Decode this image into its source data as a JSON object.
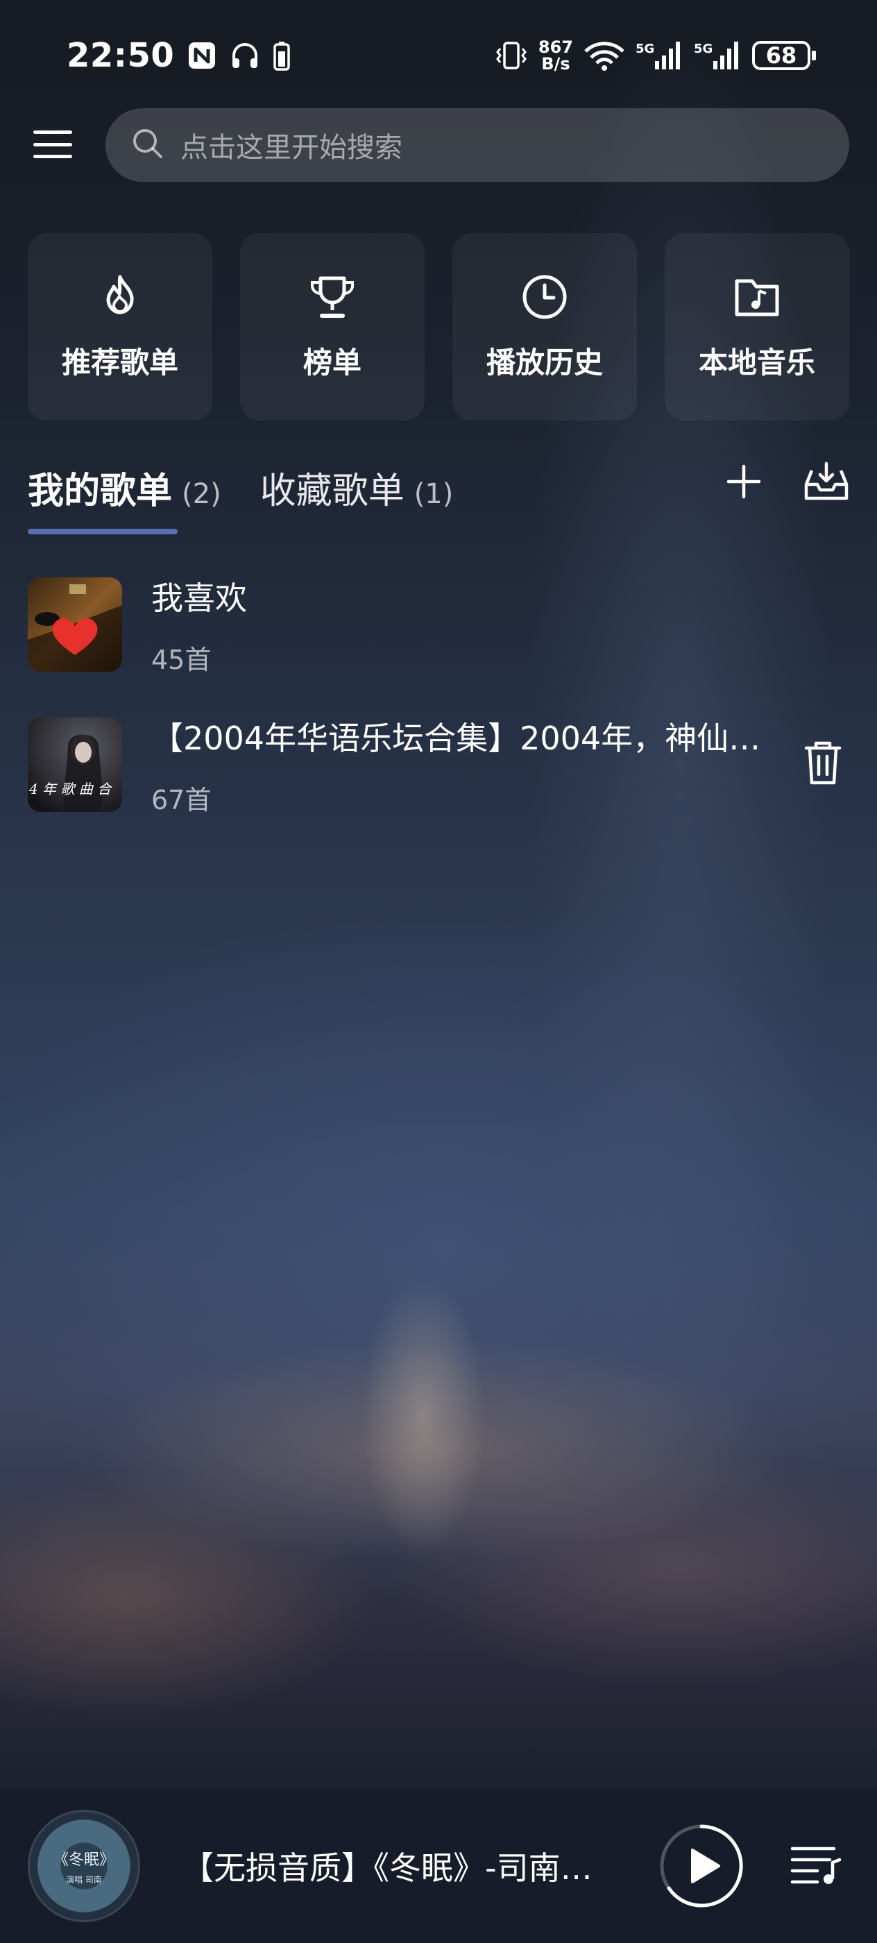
{
  "status_bar": {
    "time": "22:50",
    "net_speed_value": "867",
    "net_speed_unit": "B/s",
    "signal1_label": "5G",
    "signal2_label": "5G",
    "battery": "68",
    "icons": [
      "nfc-icon",
      "headphones-icon",
      "battery-small-icon",
      "vibrate-icon",
      "wifi-icon",
      "signal-icon",
      "signal-icon"
    ]
  },
  "header": {
    "search_placeholder": "点击这里开始搜索"
  },
  "tiles": [
    {
      "label": "推荐歌单",
      "icon": "flame-icon"
    },
    {
      "label": "榜单",
      "icon": "trophy-icon"
    },
    {
      "label": "播放历史",
      "icon": "clock-icon"
    },
    {
      "label": "本地音乐",
      "icon": "music-folder-icon"
    }
  ],
  "tabs": [
    {
      "label": "我的歌单",
      "count": "(2)",
      "active": true
    },
    {
      "label": "收藏歌单",
      "count": "(1)",
      "active": false
    }
  ],
  "playlists": [
    {
      "name": "我喜欢",
      "count": "45首"
    },
    {
      "name": "【2004年华语乐坛合集】2004年，神仙…",
      "count": "67首",
      "cover_text": "4 年 歌 曲 合"
    }
  ],
  "player": {
    "now_playing": "【无损音质】《冬眠》-司南…",
    "disc_title": "《冬眠》",
    "disc_sub": "演唱 司南"
  },
  "colors": {
    "tab_underline": "#5b6fb3",
    "heart": "#e8302c",
    "player_bg": "#171c2a"
  }
}
